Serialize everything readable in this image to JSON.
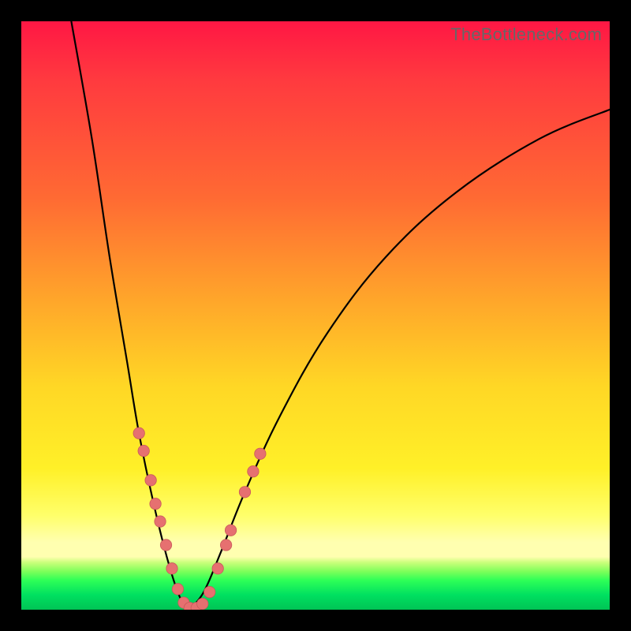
{
  "watermark": "TheBottleneck.com",
  "colors": {
    "background": "#000000",
    "gradient_top": "#ff1744",
    "gradient_mid": "#ffd725",
    "gradient_pale": "#ffffb0",
    "gradient_green": "#00c455",
    "curve_stroke": "#000000",
    "dot_fill": "#e67070"
  },
  "chart_data": {
    "type": "line",
    "title": "",
    "xlabel": "",
    "ylabel": "",
    "xlim": [
      0,
      100
    ],
    "ylim": [
      0,
      100
    ],
    "grid": false,
    "legend": false,
    "note": "Two smooth curves forming a V shape; minimum (bottom of V) at approx (x=28, y=0). Vertical gradient background encodes the y value (red high → green low). Salmon dots mark sample points along both branches near the bottom.",
    "series": [
      {
        "name": "left-branch",
        "description": "steep descending curve from top-left into the V trough",
        "points": [
          {
            "x": 8.5,
            "y": 100
          },
          {
            "x": 12,
            "y": 80
          },
          {
            "x": 15,
            "y": 60
          },
          {
            "x": 18,
            "y": 42
          },
          {
            "x": 20,
            "y": 30
          },
          {
            "x": 22.5,
            "y": 18
          },
          {
            "x": 25,
            "y": 8
          },
          {
            "x": 27,
            "y": 2
          },
          {
            "x": 28.5,
            "y": 0
          }
        ]
      },
      {
        "name": "right-branch",
        "description": "ascending curve from V trough sweeping to upper right, flattening",
        "points": [
          {
            "x": 28.5,
            "y": 0
          },
          {
            "x": 31,
            "y": 3
          },
          {
            "x": 34,
            "y": 10
          },
          {
            "x": 38,
            "y": 20
          },
          {
            "x": 44,
            "y": 33
          },
          {
            "x": 52,
            "y": 47
          },
          {
            "x": 62,
            "y": 60
          },
          {
            "x": 74,
            "y": 71
          },
          {
            "x": 88,
            "y": 80
          },
          {
            "x": 100,
            "y": 85
          }
        ]
      }
    ],
    "markers": [
      {
        "branch": "left",
        "x": 20.0,
        "y": 30
      },
      {
        "branch": "left",
        "x": 20.8,
        "y": 27
      },
      {
        "branch": "left",
        "x": 22.0,
        "y": 22
      },
      {
        "branch": "left",
        "x": 22.8,
        "y": 18
      },
      {
        "branch": "left",
        "x": 23.6,
        "y": 15
      },
      {
        "branch": "left",
        "x": 24.6,
        "y": 11
      },
      {
        "branch": "left",
        "x": 25.6,
        "y": 7
      },
      {
        "branch": "left",
        "x": 26.6,
        "y": 3.5
      },
      {
        "branch": "left",
        "x": 27.6,
        "y": 1.2
      },
      {
        "branch": "left",
        "x": 28.6,
        "y": 0.3
      },
      {
        "branch": "right",
        "x": 29.8,
        "y": 0.3
      },
      {
        "branch": "right",
        "x": 30.8,
        "y": 1.0
      },
      {
        "branch": "right",
        "x": 32.0,
        "y": 3.0
      },
      {
        "branch": "right",
        "x": 33.4,
        "y": 7.0
      },
      {
        "branch": "right",
        "x": 34.8,
        "y": 11.0
      },
      {
        "branch": "right",
        "x": 35.6,
        "y": 13.5
      },
      {
        "branch": "right",
        "x": 38.0,
        "y": 20.0
      },
      {
        "branch": "right",
        "x": 39.4,
        "y": 23.5
      },
      {
        "branch": "right",
        "x": 40.6,
        "y": 26.5
      }
    ]
  }
}
